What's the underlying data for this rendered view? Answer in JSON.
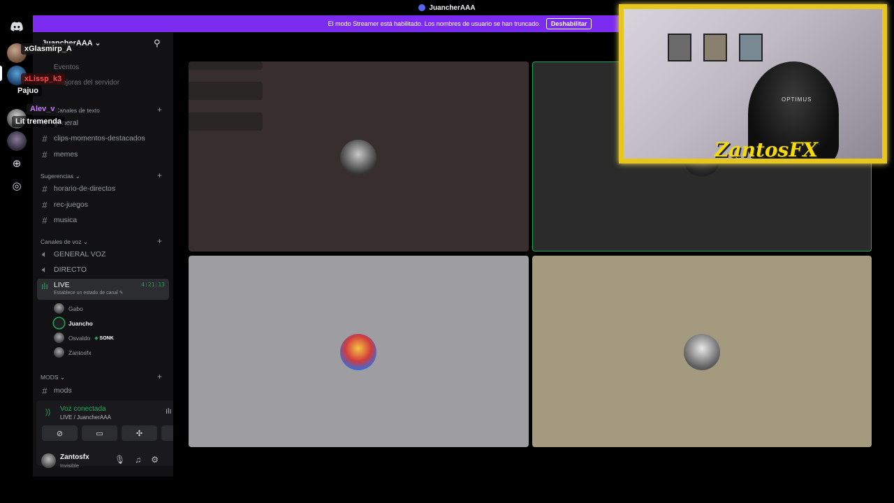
{
  "window": {
    "title": "JuancherAAA"
  },
  "banner": {
    "text": "El modo Streamer está habilitado. Los nombres de usuario se han truncado.",
    "button": "Deshabilitar"
  },
  "overlay": {
    "names": [
      "xGlasmirp_A",
      "xLissp_k3",
      "Pajuo",
      "Alev_v",
      "Lit tremenda"
    ],
    "colors": {
      "xGlasmirp_A": "#ffffff",
      "xLissp_k3": "#ff4a4a",
      "Pajuo": "#ffffff",
      "Alev_v": "#c77dff",
      "Lit tremenda": "#ffffff"
    }
  },
  "sidebar": {
    "server_name": "JuancherAAA",
    "ghost": [
      "Eventos",
      "Mejoras del servidor"
    ],
    "text_category": "Canales de texto",
    "text_channels": [
      "general",
      "clips-momentos-destacados",
      "memes"
    ],
    "sug_category": "Sugerencias",
    "sug_channels": [
      "horario-de-directos",
      "rec-juegos",
      "musica"
    ],
    "voice_category": "Canales de voz",
    "voice_channels": [
      "GENERAL VOZ",
      "DIRECTO"
    ],
    "live": {
      "name": "LIVE",
      "timer": "4:21:13",
      "status": "Establece un estado de canal"
    },
    "live_users": [
      "Gabo",
      "Juancho",
      "Osvaldo",
      "Zantosfx"
    ],
    "osvaldo_badge": "SONK",
    "mods_category": "MODS",
    "mods_channels": [
      "mods"
    ]
  },
  "voice": {
    "status": "Voz conectada",
    "location": "LIVE / JuancherAAA"
  },
  "user": {
    "name": "Zantosfx",
    "status": "Invisible"
  },
  "cam": {
    "brand": "OPTIMUS",
    "logo": "ZantosFX"
  },
  "colors": {
    "accent": "#7b2cf0",
    "green": "#23a55a",
    "gold": "#e7c61f"
  }
}
